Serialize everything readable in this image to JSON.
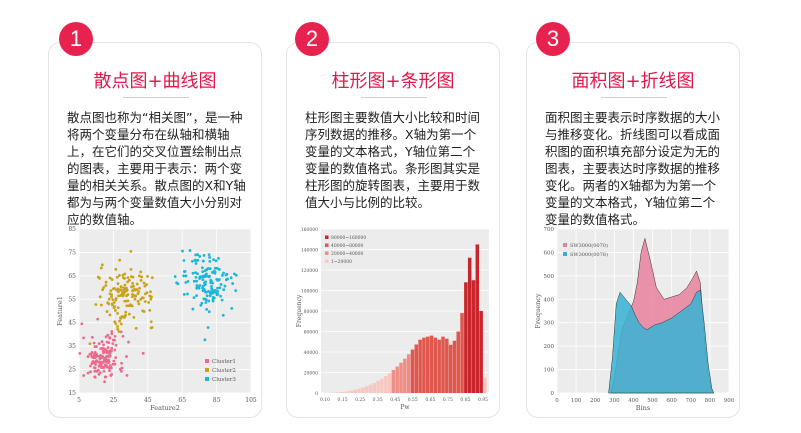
{
  "cards": [
    {
      "number": "1",
      "title": "散点图+曲线图",
      "description": "散点图也称为“相关图”，是一种将两个变量分布在纵轴和横轴上，在它们的交叉位置绘制出点的图表，主要用于表示：两个变量的相关关系。散点图的X和Y轴都为与两个变量数值大小分别对应的数值轴。"
    },
    {
      "number": "2",
      "title": "柱形图+条形图",
      "description": "柱形图主要数值大小比较和时间序列数据的推移。X轴为第一个变量的文本格式，Y轴位第二个变量的数值格式。条形图其实是柱形图的旋转图表，主要用于数值大小与比例的比较。"
    },
    {
      "number": "3",
      "title": "面积图+折线图",
      "description": "面积图主要表示时序数据的大小与推移变化。折线图可以看成面积图的面积填充部分设定为无的图表，主要表达时序数据的推移变化。两者的X轴都为为第一个变量的文本格式，Y轴位第二个变量的数值格式。"
    }
  ],
  "chart_data": [
    {
      "type": "scatter",
      "xlabel": "Feature2",
      "ylabel": "Feature1",
      "xticks": [
        "5",
        "25",
        "45",
        "65",
        "85",
        "105"
      ],
      "yticks": [
        "15",
        "25",
        "35",
        "45",
        "55",
        "65",
        "75",
        "85"
      ],
      "xlim": [
        5,
        105
      ],
      "ylim": [
        15,
        85
      ],
      "grid": true,
      "legend_position": "bottom-right",
      "series": [
        {
          "name": "Cluster1",
          "color": "#ec6a8c",
          "center": [
            19,
            30
          ],
          "spread": [
            6,
            5
          ]
        },
        {
          "name": "Cluster2",
          "color": "#c9a316",
          "center": [
            33,
            57
          ],
          "spread": [
            8,
            6
          ]
        },
        {
          "name": "Cluster3",
          "color": "#1bb7d8",
          "center": [
            80,
            62
          ],
          "spread": [
            8,
            6
          ]
        }
      ]
    },
    {
      "type": "bar",
      "xlabel": "Pw",
      "ylabel": "Frequency",
      "xticks": [
        "0.10",
        "0.15",
        "0.25",
        "0.35",
        "0.45",
        "0.55",
        "0.65",
        "0.75",
        "0.85",
        "0.95"
      ],
      "yticks": [
        "0",
        "20000",
        "40000",
        "60000",
        "80000",
        "100000",
        "120000",
        "140000",
        "160000"
      ],
      "ylim": [
        0,
        160000
      ],
      "legend_position": "top-left",
      "legend": [
        "80000~160000",
        "40000~80000",
        "20000~40000",
        "1~20000"
      ],
      "values": [
        100,
        200,
        300,
        500,
        800,
        1200,
        1700,
        2400,
        3200,
        4200,
        5300,
        6600,
        8100,
        9800,
        11800,
        14000,
        16500,
        19300,
        22400,
        25800,
        29500,
        33500,
        37800,
        42400,
        47300,
        52000,
        54000,
        55000,
        56000,
        54000,
        52000,
        55000,
        53000,
        47000,
        51000,
        60000,
        78000,
        108000,
        132000,
        110000,
        145000,
        80000,
        15000
      ]
    },
    {
      "type": "area",
      "xlabel": "Bins",
      "ylabel": "Frequency",
      "xticks": [
        "0",
        "100",
        "200",
        "300",
        "400",
        "500",
        "600",
        "700",
        "800",
        "900"
      ],
      "yticks": [
        "0",
        "100",
        "200",
        "300",
        "400",
        "500",
        "600",
        "700"
      ],
      "xlim": [
        0,
        900
      ],
      "ylim": [
        0,
        700
      ],
      "legend_position": "top-left",
      "series": [
        {
          "name": "SW3000(0070)",
          "color": "#e8819c",
          "x": [
            280,
            300,
            320,
            340,
            370,
            400,
            420,
            440,
            460,
            490,
            520,
            560,
            600,
            640,
            680,
            710,
            730,
            750,
            770,
            790,
            810,
            820
          ],
          "values": [
            0,
            60,
            170,
            270,
            330,
            390,
            470,
            600,
            660,
            560,
            450,
            400,
            410,
            420,
            450,
            490,
            520,
            470,
            250,
            80,
            10,
            0
          ]
        },
        {
          "name": "SW3000(0078)",
          "color": "#36b3d3",
          "x": [
            270,
            290,
            310,
            330,
            350,
            370,
            390,
            410,
            430,
            450,
            470,
            490,
            510,
            550,
            600,
            650,
            700,
            730,
            750,
            770,
            790,
            810,
            820
          ],
          "values": [
            0,
            150,
            380,
            430,
            410,
            390,
            370,
            330,
            300,
            280,
            270,
            280,
            290,
            300,
            320,
            350,
            380,
            430,
            440,
            300,
            130,
            20,
            0
          ]
        }
      ]
    }
  ]
}
